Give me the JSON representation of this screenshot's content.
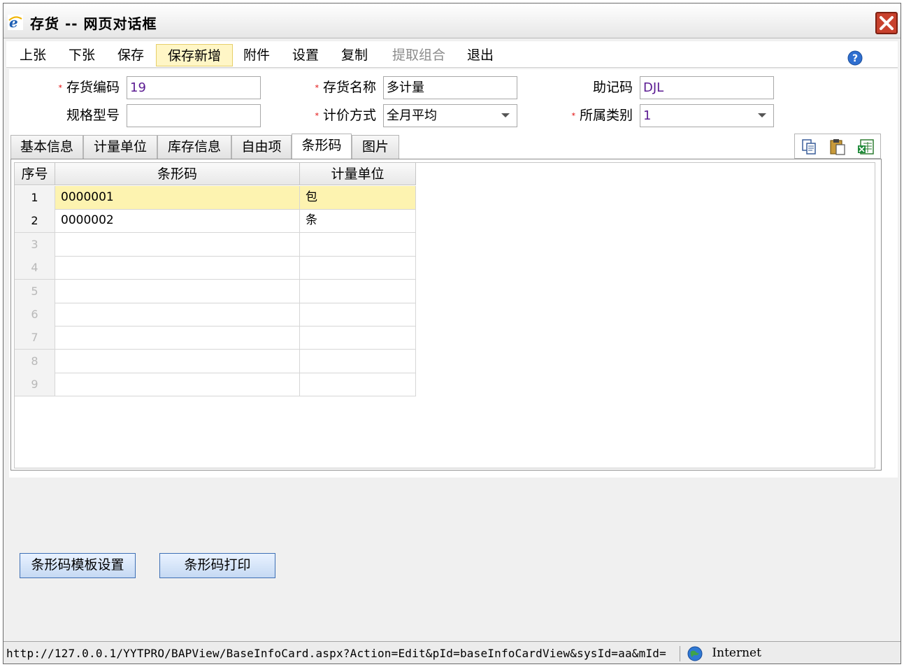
{
  "window": {
    "title": "存货  --  网页对话框"
  },
  "toolbar": {
    "items": [
      {
        "label": "上张",
        "state": "normal"
      },
      {
        "label": "下张",
        "state": "normal"
      },
      {
        "label": "保存",
        "state": "normal"
      },
      {
        "label": "保存新增",
        "state": "active"
      },
      {
        "label": "附件",
        "state": "normal"
      },
      {
        "label": "设置",
        "state": "normal"
      },
      {
        "label": "复制",
        "state": "normal"
      },
      {
        "label": "提取组合",
        "state": "disabled"
      },
      {
        "label": "退出",
        "state": "normal"
      }
    ]
  },
  "form": {
    "code_label": "存货编码",
    "code_value": "19",
    "name_label": "存货名称",
    "name_value": "多计量",
    "mnemonic_label": "助记码",
    "mnemonic_value": "DJL",
    "spec_label": "规格型号",
    "spec_value": "",
    "pricing_label": "计价方式",
    "pricing_value": "全月平均",
    "category_label": "所属类别",
    "category_value": "1"
  },
  "tabs": [
    "基本信息",
    "计量单位",
    "库存信息",
    "自由项",
    "条形码",
    "图片"
  ],
  "active_tab": "条形码",
  "grid": {
    "columns": [
      "序号",
      "条形码",
      "计量单位"
    ],
    "rows": [
      {
        "no": "1",
        "barcode": "0000001",
        "unit": "包"
      },
      {
        "no": "2",
        "barcode": "0000002",
        "unit": "条"
      },
      {
        "no": "3",
        "barcode": "",
        "unit": ""
      },
      {
        "no": "4",
        "barcode": "",
        "unit": ""
      },
      {
        "no": "5",
        "barcode": "",
        "unit": ""
      },
      {
        "no": "6",
        "barcode": "",
        "unit": ""
      },
      {
        "no": "7",
        "barcode": "",
        "unit": ""
      },
      {
        "no": "8",
        "barcode": "",
        "unit": ""
      },
      {
        "no": "9",
        "barcode": "",
        "unit": ""
      }
    ]
  },
  "buttons": {
    "template_setup": "条形码模板设置",
    "print": "条形码打印"
  },
  "statusbar": {
    "url": "http://127.0.0.1/YYTPRO/BAPView/BaseInfoCard.aspx?Action=Edit&pId=baseInfoCardView&sysId=aa&mId=",
    "zone": "Internet"
  },
  "icons": {
    "app": "ie-icon",
    "close": "close-icon",
    "help": "help-icon",
    "copy": "copy-icon",
    "paste": "paste-icon",
    "excel": "excel-export-icon",
    "zone": "globe-icon"
  },
  "colors": {
    "active_toolbar_bg": "#fff6c6",
    "row_highlight": "#fdf3b0",
    "required_star": "#e00000",
    "button_border": "#3d6fb5"
  }
}
